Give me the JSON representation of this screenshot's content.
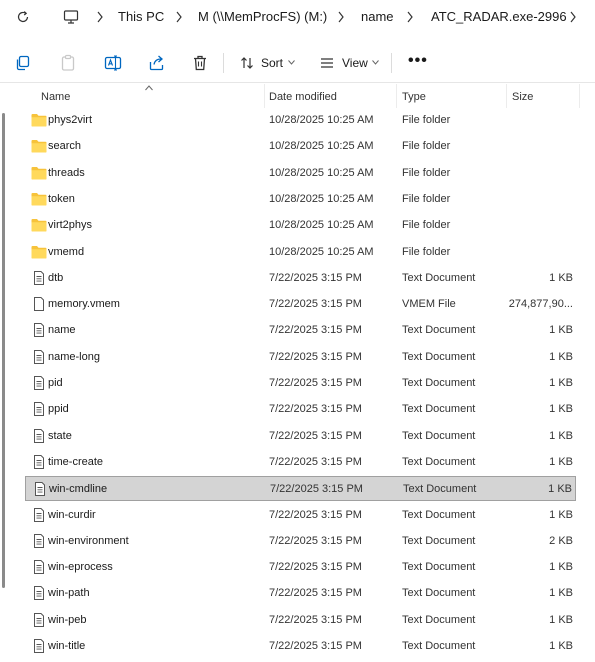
{
  "address_bar": {
    "crumbs": [
      "This PC",
      "M (\\\\MemProcFS) (M:)",
      "name",
      "ATC_RADAR.exe-2996"
    ]
  },
  "toolbar": {
    "sort_label": "Sort",
    "view_label": "View",
    "more_label": "•••"
  },
  "columns": {
    "name": "Name",
    "date": "Date modified",
    "type": "Type",
    "size": "Size"
  },
  "colors": {
    "folder": "#f7c33b",
    "selected_bg": "#d4d4d4",
    "accent": "#0067c0"
  },
  "rows": [
    {
      "icon": "folder-icon",
      "name": "phys2virt",
      "date": "10/28/2025 10:25 AM",
      "type": "File folder",
      "size": ""
    },
    {
      "icon": "folder-icon",
      "name": "search",
      "date": "10/28/2025 10:25 AM",
      "type": "File folder",
      "size": ""
    },
    {
      "icon": "folder-icon",
      "name": "threads",
      "date": "10/28/2025 10:25 AM",
      "type": "File folder",
      "size": ""
    },
    {
      "icon": "folder-icon",
      "name": "token",
      "date": "10/28/2025 10:25 AM",
      "type": "File folder",
      "size": ""
    },
    {
      "icon": "folder-icon",
      "name": "virt2phys",
      "date": "10/28/2025 10:25 AM",
      "type": "File folder",
      "size": ""
    },
    {
      "icon": "folder-icon",
      "name": "vmemd",
      "date": "10/28/2025 10:25 AM",
      "type": "File folder",
      "size": ""
    },
    {
      "icon": "document-icon",
      "name": "dtb",
      "date": "7/22/2025 3:15 PM",
      "type": "Text Document",
      "size": "1 KB"
    },
    {
      "icon": "file-icon",
      "name": "memory.vmem",
      "date": "7/22/2025 3:15 PM",
      "type": "VMEM File",
      "size": "274,877,90..."
    },
    {
      "icon": "document-icon",
      "name": "name",
      "date": "7/22/2025 3:15 PM",
      "type": "Text Document",
      "size": "1 KB"
    },
    {
      "icon": "document-icon",
      "name": "name-long",
      "date": "7/22/2025 3:15 PM",
      "type": "Text Document",
      "size": "1 KB"
    },
    {
      "icon": "document-icon",
      "name": "pid",
      "date": "7/22/2025 3:15 PM",
      "type": "Text Document",
      "size": "1 KB"
    },
    {
      "icon": "document-icon",
      "name": "ppid",
      "date": "7/22/2025 3:15 PM",
      "type": "Text Document",
      "size": "1 KB"
    },
    {
      "icon": "document-icon",
      "name": "state",
      "date": "7/22/2025 3:15 PM",
      "type": "Text Document",
      "size": "1 KB"
    },
    {
      "icon": "document-icon",
      "name": "time-create",
      "date": "7/22/2025 3:15 PM",
      "type": "Text Document",
      "size": "1 KB"
    },
    {
      "icon": "document-icon",
      "name": "win-cmdline",
      "date": "7/22/2025 3:15 PM",
      "type": "Text Document",
      "size": "1 KB",
      "selected": true
    },
    {
      "icon": "document-icon",
      "name": "win-curdir",
      "date": "7/22/2025 3:15 PM",
      "type": "Text Document",
      "size": "1 KB"
    },
    {
      "icon": "document-icon",
      "name": "win-environment",
      "date": "7/22/2025 3:15 PM",
      "type": "Text Document",
      "size": "2 KB"
    },
    {
      "icon": "document-icon",
      "name": "win-eprocess",
      "date": "7/22/2025 3:15 PM",
      "type": "Text Document",
      "size": "1 KB"
    },
    {
      "icon": "document-icon",
      "name": "win-path",
      "date": "7/22/2025 3:15 PM",
      "type": "Text Document",
      "size": "1 KB"
    },
    {
      "icon": "document-icon",
      "name": "win-peb",
      "date": "7/22/2025 3:15 PM",
      "type": "Text Document",
      "size": "1 KB"
    },
    {
      "icon": "document-icon",
      "name": "win-title",
      "date": "7/22/2025 3:15 PM",
      "type": "Text Document",
      "size": "1 KB"
    }
  ]
}
